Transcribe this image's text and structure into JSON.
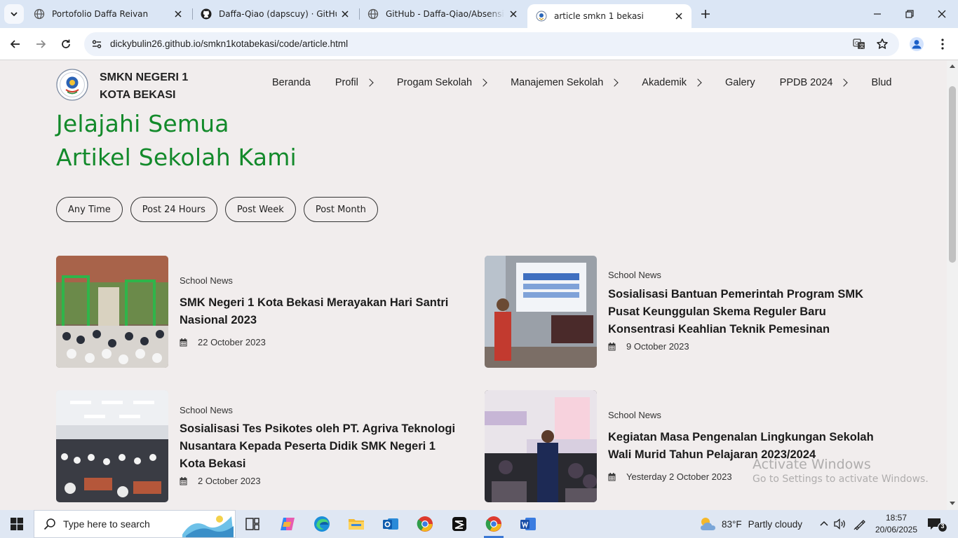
{
  "browser": {
    "tabs": [
      {
        "title": "Portofolio Daffa Reivan",
        "favicon": "globe-icon"
      },
      {
        "title": "Daffa-Qiao (dapscuy) · GitHub",
        "favicon": "github-icon"
      },
      {
        "title": "GitHub - Daffa-Qiao/Absensi-PKL",
        "favicon": "globe-icon"
      },
      {
        "title": "article smkn 1 bekasi",
        "favicon": "school-logo-icon",
        "active": true
      }
    ],
    "url": "dickybulin26.github.io/smkn1kotabekasi/code/article.html"
  },
  "site": {
    "school_name_line1": "SMKN NEGERI 1",
    "school_name_line2": "KOTA BEKASI",
    "nav": [
      {
        "label": "Beranda",
        "dropdown": false
      },
      {
        "label": "Profil",
        "dropdown": true
      },
      {
        "label": "Progam Sekolah",
        "dropdown": true
      },
      {
        "label": "Manajemen Sekolah",
        "dropdown": true
      },
      {
        "label": "Akademik",
        "dropdown": true
      },
      {
        "label": "Galery",
        "dropdown": false
      },
      {
        "label": "PPDB 2024",
        "dropdown": true
      },
      {
        "label": "Blud",
        "dropdown": false
      }
    ],
    "headline_line1": "Jelajahi Semua",
    "headline_line2": "Artikel Sekolah Kami",
    "filters": [
      "Any Time",
      "Post 24 Hours",
      "Post Week",
      "Post Month"
    ],
    "articles": [
      {
        "category": "School News",
        "title": "SMK Negeri 1 Kota Bekasi Merayakan Hari Santri Nasional 2023",
        "date": "22 October 2023"
      },
      {
        "category": "School News",
        "title": "Sosialisasi Bantuan Pemerintah Program SMK Pusat Keunggulan Skema Reguler Baru Konsentrasi Keahlian Teknik Pemesinan",
        "date": "9 October 2023"
      },
      {
        "category": "School News",
        "title": "Sosialisasi Tes Psikotes oleh PT. Agriva Teknologi Nusantara Kepada Peserta Didik SMK Negeri 1 Kota Bekasi",
        "date": "2 October 2023"
      },
      {
        "category": "School News",
        "title": "Kegiatan Masa Pengenalan Lingkungan Sekolah Wali Murid Tahun Pelajaran 2023/2024",
        "date": "Yesterday 2 October 2023"
      }
    ],
    "accent_color": "#138a2b"
  },
  "watermark": {
    "line1": "Activate Windows",
    "line2": "Go to Settings to activate Windows."
  },
  "taskbar": {
    "search_placeholder": "Type here to search",
    "weather_temp": "83°F",
    "weather_text": "Partly cloudy",
    "time": "18:57",
    "date": "20/06/2025",
    "notification_count": "3"
  }
}
